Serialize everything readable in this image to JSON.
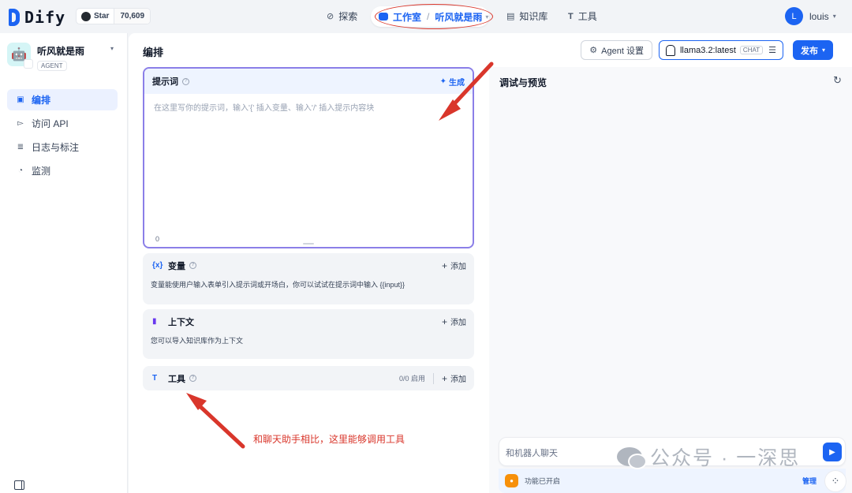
{
  "topbar": {
    "logo_text": "Dify",
    "github_star_label": "Star",
    "github_star_count": "70,609",
    "nav": {
      "explore": "探索",
      "studio": "工作室",
      "current_app": "听风就是雨",
      "knowledge": "知识库",
      "tools": "工具"
    },
    "user_initial": "L",
    "user_name": "louis"
  },
  "sidebar": {
    "app_name": "听风就是雨",
    "app_type": "AGENT",
    "items": [
      {
        "label": "编排",
        "icon": "layout-icon",
        "active": true
      },
      {
        "label": "访问 API",
        "icon": "terminal-icon",
        "active": false
      },
      {
        "label": "日志与标注",
        "icon": "file-list-icon",
        "active": false
      },
      {
        "label": "监测",
        "icon": "dashboard-icon",
        "active": false
      }
    ]
  },
  "main": {
    "title": "编排",
    "agent_settings_label": "Agent 设置",
    "model_name": "llama3.2:latest",
    "model_mode": "CHAT",
    "publish_label": "发布"
  },
  "prompt": {
    "title": "提示词",
    "generate_label": "生成",
    "placeholder": "在这里写你的提示词，输入'{' 插入变量、输入'/' 插入提示内容块",
    "char_count": "0"
  },
  "variables": {
    "title": "变量",
    "add_label": "添加",
    "description": "变量能使用户输入表单引入提示词或开场白，你可以试试在提示词中输入 {{input}}"
  },
  "context": {
    "title": "上下文",
    "add_label": "添加",
    "description": "您可以导入知识库作为上下文"
  },
  "tools": {
    "title": "工具",
    "enabled_count": "0/0 启用",
    "add_label": "添加"
  },
  "annotation_text": "和聊天助手相比，这里能够调用工具",
  "debug": {
    "title": "调试与预览",
    "chat_placeholder": "和机器人聊天",
    "feature_text": "功能已开启",
    "manage_label": "管理"
  },
  "watermark": "公众号 · 一深思",
  "colors": {
    "accent": "#1c64f2",
    "annotation_red": "#d9362b",
    "prompt_border": "#8b7fe8"
  }
}
